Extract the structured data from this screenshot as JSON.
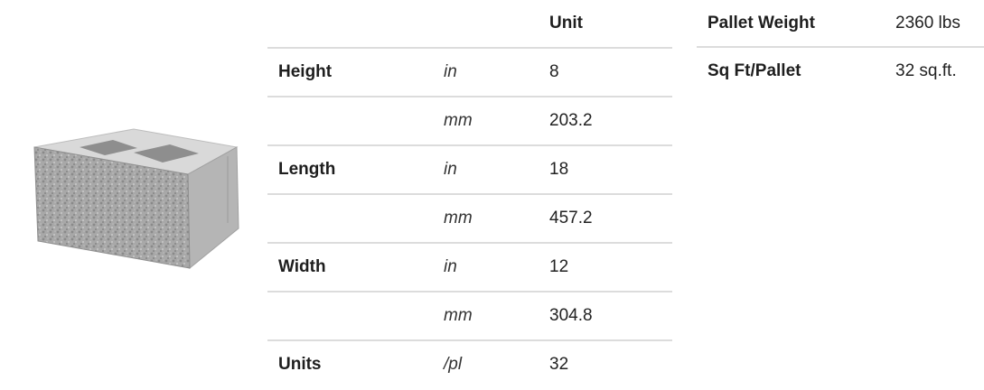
{
  "product": {
    "image_icon": "concrete-retaining-wall-block"
  },
  "spec_table": {
    "header": {
      "label": "",
      "unit": "",
      "value": "Unit"
    },
    "rows": [
      {
        "label": "Height",
        "unit": "in",
        "value": "8"
      },
      {
        "label": "",
        "unit": "mm",
        "value": "203.2"
      },
      {
        "label": "Length",
        "unit": "in",
        "value": "18"
      },
      {
        "label": "",
        "unit": "mm",
        "value": "457.2"
      },
      {
        "label": "Width",
        "unit": "in",
        "value": "12"
      },
      {
        "label": "",
        "unit": "mm",
        "value": "304.8"
      },
      {
        "label": "Units",
        "unit": "/pl",
        "value": "32"
      }
    ]
  },
  "pallet_table": {
    "rows": [
      {
        "label": "Pallet Weight",
        "value": "2360 lbs"
      },
      {
        "label": "Sq Ft/Pallet",
        "value": "32 sq.ft."
      }
    ]
  }
}
